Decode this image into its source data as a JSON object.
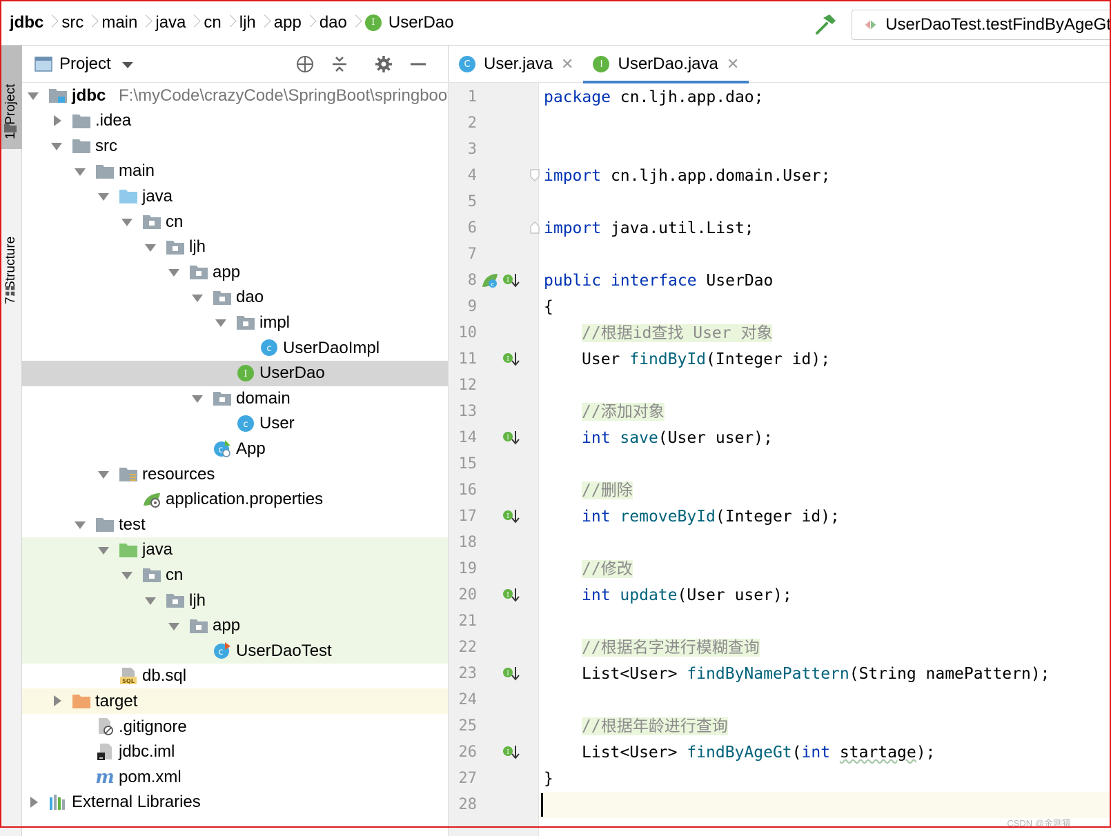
{
  "breadcrumb": {
    "items": [
      "jdbc",
      "src",
      "main",
      "java",
      "cn",
      "ljh",
      "app",
      "dao"
    ],
    "current": "UserDao",
    "current_badge": "I"
  },
  "toolbar": {
    "build_icon": "hammer-icon",
    "run_config": "UserDaoTest.testFindByAgeGt"
  },
  "tool_strip": {
    "project": "1: Project",
    "structure": "7: Structure"
  },
  "project_panel": {
    "title": "Project",
    "tools": [
      "locate-icon",
      "collapse-all-icon",
      "gear-icon",
      "minimize-icon"
    ],
    "tree": [
      {
        "label": "jdbc",
        "path": "F:\\myCode\\crazyCode\\SpringBoot\\springboot",
        "depth": 0,
        "arrow": "down",
        "icon": "module-folder-icon",
        "bold": true
      },
      {
        "label": ".idea",
        "depth": 1,
        "arrow": "right",
        "icon": "folder-icon"
      },
      {
        "label": "src",
        "depth": 1,
        "arrow": "down",
        "icon": "folder-icon"
      },
      {
        "label": "main",
        "depth": 2,
        "arrow": "down",
        "icon": "folder-icon"
      },
      {
        "label": "java",
        "depth": 3,
        "arrow": "down",
        "icon": "source-folder-icon"
      },
      {
        "label": "cn",
        "depth": 4,
        "arrow": "down",
        "icon": "package-icon"
      },
      {
        "label": "ljh",
        "depth": 5,
        "arrow": "down",
        "icon": "package-icon"
      },
      {
        "label": "app",
        "depth": 6,
        "arrow": "down",
        "icon": "package-icon"
      },
      {
        "label": "dao",
        "depth": 7,
        "arrow": "down",
        "icon": "package-icon"
      },
      {
        "label": "impl",
        "depth": 8,
        "arrow": "down",
        "icon": "package-icon"
      },
      {
        "label": "UserDaoImpl",
        "depth": 9,
        "arrow": "",
        "icon": "class-icon"
      },
      {
        "label": "UserDao",
        "depth": 8,
        "arrow": "",
        "icon": "interface-icon",
        "state": "selected"
      },
      {
        "label": "domain",
        "depth": 7,
        "arrow": "down",
        "icon": "package-icon"
      },
      {
        "label": "User",
        "depth": 8,
        "arrow": "",
        "icon": "class-icon"
      },
      {
        "label": "App",
        "depth": 7,
        "arrow": "",
        "icon": "spring-class-icon"
      },
      {
        "label": "resources",
        "depth": 3,
        "arrow": "down",
        "icon": "resources-folder-icon"
      },
      {
        "label": "application.properties",
        "depth": 4,
        "arrow": "",
        "icon": "spring-properties-icon"
      },
      {
        "label": "test",
        "depth": 2,
        "arrow": "down",
        "icon": "folder-icon"
      },
      {
        "label": "java",
        "depth": 3,
        "arrow": "down",
        "icon": "test-folder-icon",
        "state": "test"
      },
      {
        "label": "cn",
        "depth": 4,
        "arrow": "down",
        "icon": "package-icon",
        "state": "test"
      },
      {
        "label": "ljh",
        "depth": 5,
        "arrow": "down",
        "icon": "package-icon",
        "state": "test"
      },
      {
        "label": "app",
        "depth": 6,
        "arrow": "down",
        "icon": "package-icon",
        "state": "test"
      },
      {
        "label": "UserDaoTest",
        "depth": 7,
        "arrow": "",
        "icon": "test-class-icon",
        "state": "test"
      },
      {
        "label": "db.sql",
        "depth": 3,
        "arrow": "",
        "icon": "sql-file-icon"
      },
      {
        "label": "target",
        "depth": 1,
        "arrow": "right",
        "icon": "excluded-folder-icon",
        "state": "excluded"
      },
      {
        "label": ".gitignore",
        "depth": 2,
        "arrow": "",
        "icon": "ignore-file-icon"
      },
      {
        "label": "jdbc.iml",
        "depth": 2,
        "arrow": "",
        "icon": "iml-file-icon"
      },
      {
        "label": "pom.xml",
        "depth": 2,
        "arrow": "",
        "icon": "maven-icon"
      },
      {
        "label": "External Libraries",
        "depth": 0,
        "arrow": "right",
        "icon": "libraries-icon"
      }
    ]
  },
  "editor": {
    "tabs": [
      {
        "label": "User.java",
        "badge": "C",
        "badge_color": "#40a8e0",
        "active": false
      },
      {
        "label": "UserDao.java",
        "badge": "I",
        "badge_color": "#62b543",
        "active": true
      }
    ],
    "line_numbers": [
      "1",
      "2",
      "3",
      "4",
      "5",
      "6",
      "7",
      "8",
      "9",
      "10",
      "11",
      "12",
      "13",
      "14",
      "15",
      "16",
      "17",
      "18",
      "19",
      "20",
      "21",
      "22",
      "23",
      "24",
      "25",
      "26",
      "27",
      "28"
    ],
    "lines": [
      {
        "n": 1,
        "indent": 0,
        "tokens": [
          {
            "t": "package",
            "c": "kw"
          },
          {
            "t": " cn.ljh.app.dao;"
          }
        ]
      },
      {
        "n": 2,
        "indent": 0,
        "tokens": []
      },
      {
        "n": 3,
        "indent": 0,
        "tokens": []
      },
      {
        "n": 4,
        "indent": 0,
        "tokens": [
          {
            "t": "import",
            "c": "kw"
          },
          {
            "t": " cn.ljh.app.domain.User;"
          }
        ],
        "fold": "open"
      },
      {
        "n": 5,
        "indent": 0,
        "tokens": []
      },
      {
        "n": 6,
        "indent": 0,
        "tokens": [
          {
            "t": "import",
            "c": "kw"
          },
          {
            "t": " java.util.List;"
          }
        ],
        "fold": "close"
      },
      {
        "n": 7,
        "indent": 0,
        "tokens": []
      },
      {
        "n": 8,
        "indent": 0,
        "tokens": [
          {
            "t": "public",
            "c": "kw"
          },
          {
            "t": " "
          },
          {
            "t": "interface",
            "c": "kw"
          },
          {
            "t": " UserDao"
          }
        ],
        "marks": [
          "spring-bean-icon",
          "implemented-icon"
        ]
      },
      {
        "n": 9,
        "indent": 0,
        "tokens": [
          {
            "t": "{"
          }
        ]
      },
      {
        "n": 10,
        "indent": 1,
        "tokens": [
          {
            "t": "//根据id查找 User 对象",
            "c": "cm"
          }
        ]
      },
      {
        "n": 11,
        "indent": 1,
        "tokens": [
          {
            "t": "User "
          },
          {
            "t": "findById",
            "c": "fn"
          },
          {
            "t": "(Integer id);"
          }
        ],
        "marks": [
          "implemented-icon"
        ]
      },
      {
        "n": 12,
        "indent": 0,
        "tokens": []
      },
      {
        "n": 13,
        "indent": 1,
        "tokens": [
          {
            "t": "//添加对象",
            "c": "cm"
          }
        ]
      },
      {
        "n": 14,
        "indent": 1,
        "tokens": [
          {
            "t": "int",
            "c": "kw"
          },
          {
            "t": " "
          },
          {
            "t": "save",
            "c": "fn"
          },
          {
            "t": "(User user);"
          }
        ],
        "marks": [
          "implemented-icon"
        ]
      },
      {
        "n": 15,
        "indent": 0,
        "tokens": []
      },
      {
        "n": 16,
        "indent": 1,
        "tokens": [
          {
            "t": "//删除",
            "c": "cm"
          }
        ]
      },
      {
        "n": 17,
        "indent": 1,
        "tokens": [
          {
            "t": "int",
            "c": "kw"
          },
          {
            "t": " "
          },
          {
            "t": "removeById",
            "c": "fn"
          },
          {
            "t": "(Integer id);"
          }
        ],
        "marks": [
          "implemented-icon"
        ]
      },
      {
        "n": 18,
        "indent": 0,
        "tokens": []
      },
      {
        "n": 19,
        "indent": 1,
        "tokens": [
          {
            "t": "//修改",
            "c": "cm"
          }
        ]
      },
      {
        "n": 20,
        "indent": 1,
        "tokens": [
          {
            "t": "int",
            "c": "kw"
          },
          {
            "t": " "
          },
          {
            "t": "update",
            "c": "fn"
          },
          {
            "t": "(User user);"
          }
        ],
        "marks": [
          "implemented-icon"
        ]
      },
      {
        "n": 21,
        "indent": 0,
        "tokens": []
      },
      {
        "n": 22,
        "indent": 1,
        "tokens": [
          {
            "t": "//根据名字进行模糊查询",
            "c": "cm"
          }
        ]
      },
      {
        "n": 23,
        "indent": 1,
        "tokens": [
          {
            "t": "List<User> "
          },
          {
            "t": "findByNamePattern",
            "c": "fn"
          },
          {
            "t": "(String namePattern);"
          }
        ],
        "marks": [
          "implemented-icon"
        ]
      },
      {
        "n": 24,
        "indent": 0,
        "tokens": []
      },
      {
        "n": 25,
        "indent": 1,
        "tokens": [
          {
            "t": "//根据年龄进行查询",
            "c": "cm"
          }
        ]
      },
      {
        "n": 26,
        "indent": 1,
        "tokens": [
          {
            "t": "List<User> "
          },
          {
            "t": "findByAgeGt",
            "c": "fn"
          },
          {
            "t": "("
          },
          {
            "t": "int",
            "c": "kw"
          },
          {
            "t": " "
          },
          {
            "t": "startage",
            "c": "under"
          },
          {
            "t": ");"
          }
        ],
        "marks": [
          "implemented-icon"
        ]
      },
      {
        "n": 27,
        "indent": 0,
        "tokens": [
          {
            "t": "}"
          }
        ]
      },
      {
        "n": 28,
        "indent": 0,
        "tokens": [],
        "current": true
      }
    ]
  },
  "watermark": "CSDN @金刚猿",
  "colors": {
    "keyword": "#0033b3",
    "method": "#00627a",
    "comment": "#8c8c8c",
    "comment_bg": "#eaf6dc",
    "interface_badge": "#62b543",
    "class_badge": "#40a8e0",
    "selection": "#d5d5d5",
    "test_bg": "#eef7e6",
    "excluded_bg": "#fbf9e3",
    "frame": "#e01818"
  }
}
